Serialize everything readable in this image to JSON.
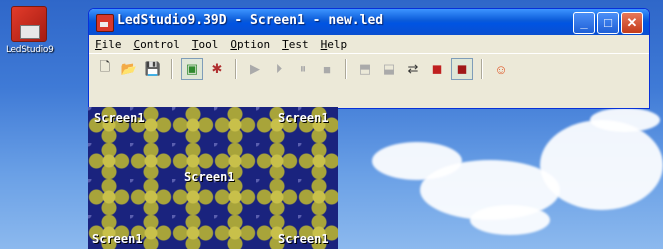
{
  "desktop": {
    "icon_label": "LedStudio9"
  },
  "window": {
    "title": "LedStudio9.39D - Screen1 - new.led",
    "controls": {
      "minimize": "_",
      "maximize": "□",
      "close": "✕"
    }
  },
  "menu": [
    "File",
    "Control",
    "Tool",
    "Option",
    "Test",
    "Help"
  ],
  "toolbar": {
    "icons": [
      {
        "name": "new-file-icon",
        "glyph": "🗋"
      },
      {
        "name": "open-folder-icon",
        "glyph": "📂"
      },
      {
        "name": "save-icon",
        "glyph": "💾"
      },
      {
        "name": "screen-preview-icon",
        "glyph": "▣"
      },
      {
        "name": "settings-wrench-icon",
        "glyph": "✱"
      },
      {
        "name": "play-icon",
        "glyph": "▶"
      },
      {
        "name": "step-icon",
        "glyph": "⏵"
      },
      {
        "name": "pause-icon",
        "glyph": "⏸"
      },
      {
        "name": "stop-icon",
        "glyph": "■"
      },
      {
        "name": "send-a-icon",
        "glyph": "⬒"
      },
      {
        "name": "send-b-icon",
        "glyph": "⬓"
      },
      {
        "name": "transfer-icon",
        "glyph": "⇄"
      },
      {
        "name": "color-red-icon",
        "glyph": "◼"
      },
      {
        "name": "color-card-icon",
        "glyph": "◼"
      },
      {
        "name": "smiley-icon",
        "glyph": "☺"
      }
    ]
  },
  "screen_panel": {
    "labels": {
      "top_left": "Screen1",
      "top_right": "Screen1",
      "center": "Screen1",
      "bottom_left": "Screen1",
      "bottom_right": "Screen1"
    }
  },
  "colors": {
    "titlebar": "#0054e3",
    "window_bg": "#ece9d8",
    "led_bg": "#1a237e",
    "led_pattern": "#c8c04a"
  }
}
